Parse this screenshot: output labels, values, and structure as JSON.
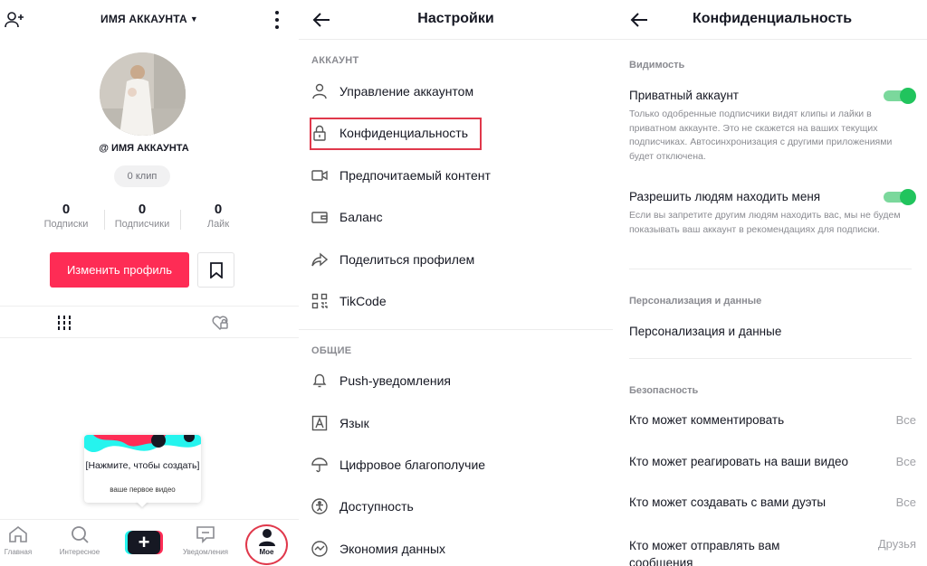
{
  "colors": {
    "accent": "#fe2c55",
    "toggle_on": "#21c45d",
    "highlight": "#e0384b"
  },
  "profile": {
    "account_title": "ИМЯ АККАУНТА",
    "handle": "@ ИМЯ АККАУНТА",
    "clips": "0 клип",
    "stats": [
      {
        "num": "0",
        "label": "Подписки"
      },
      {
        "num": "0",
        "label": "Подписчики"
      },
      {
        "num": "0",
        "label": "Лайк"
      }
    ],
    "edit_button": "Изменить профиль",
    "tooltip": {
      "line1": "[Нажмите, чтобы создать]",
      "line2": "ваше первое видео"
    },
    "nav": {
      "home": "Главная",
      "discover": "Интересное",
      "create": "+",
      "inbox": "Уведомления",
      "me": "Мое"
    }
  },
  "settings": {
    "title": "Настройки",
    "section_account": "АККАУНТ",
    "account_items": [
      {
        "label": "Управление аккаунтом",
        "icon": "person-icon"
      },
      {
        "label": "Конфиденциальность",
        "icon": "lock-icon"
      },
      {
        "label": "Предпочитаемый контент",
        "icon": "video-camera-icon"
      },
      {
        "label": "Баланс",
        "icon": "wallet-icon"
      },
      {
        "label": "Поделиться профилем",
        "icon": "share-icon"
      },
      {
        "label": "TikCode",
        "icon": "qr-code-icon"
      }
    ],
    "section_general": "ОБЩИЕ",
    "general_items": [
      {
        "label": "Push-уведомления",
        "icon": "bell-icon"
      },
      {
        "label": "Язык",
        "icon": "language-icon"
      },
      {
        "label": "Цифровое благополучие",
        "icon": "umbrella-icon"
      },
      {
        "label": "Доступность",
        "icon": "accessibility-icon"
      },
      {
        "label": "Экономия данных",
        "icon": "data-saver-icon"
      }
    ]
  },
  "privacy": {
    "title": "Конфиденциальность",
    "section_visibility": "Видимость",
    "private_account": {
      "label": "Приватный аккаунт",
      "desc": "Только одобренные подписчики видят клипы и лайки в приватном аккаунте. Это не скажется на ваших текущих подписчиках. Автосинхронизация с другими приложениями будет отключена.",
      "enabled": true
    },
    "allow_find": {
      "label": "Разрешить людям находить меня",
      "desc": "Если вы запретите другим людям находить вас, мы не будем показывать ваш аккаунт в рекомендациях для подписки.",
      "enabled": true
    },
    "section_personalization": "Персонализация и данные",
    "personalization_item": "Персонализация и данные",
    "section_safety": "Безопасность",
    "safety_items": [
      {
        "label": "Кто может комментировать",
        "value": "Все"
      },
      {
        "label": "Кто может реагировать на ваши видео",
        "value": "Все"
      },
      {
        "label": "Кто может создавать с вами дуэты",
        "value": "Все"
      },
      {
        "label": "Кто может отправлять вам сообщения",
        "value": "Друзья"
      }
    ]
  }
}
